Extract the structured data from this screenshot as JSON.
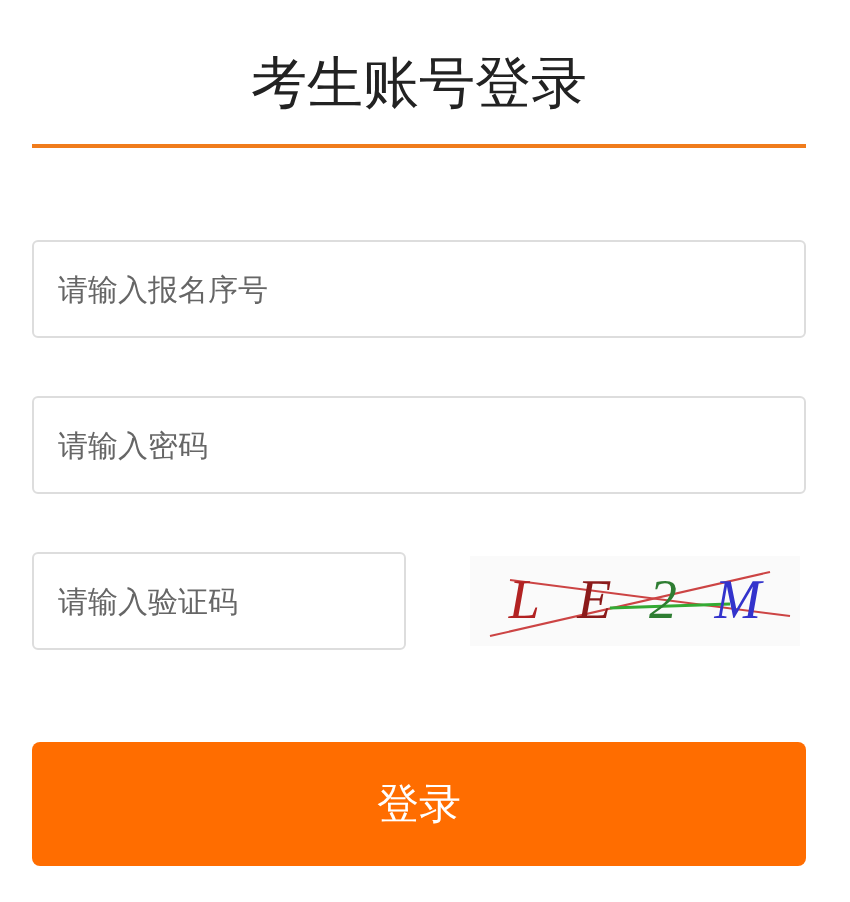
{
  "title": "考生账号登录",
  "fields": [
    {
      "placeholder": "请输入报名序号"
    },
    {
      "placeholder": "请输入密码"
    }
  ],
  "captcha": {
    "placeholder": "请输入验证码",
    "code": [
      "L",
      "E",
      "2",
      "M"
    ]
  },
  "button": "登录"
}
